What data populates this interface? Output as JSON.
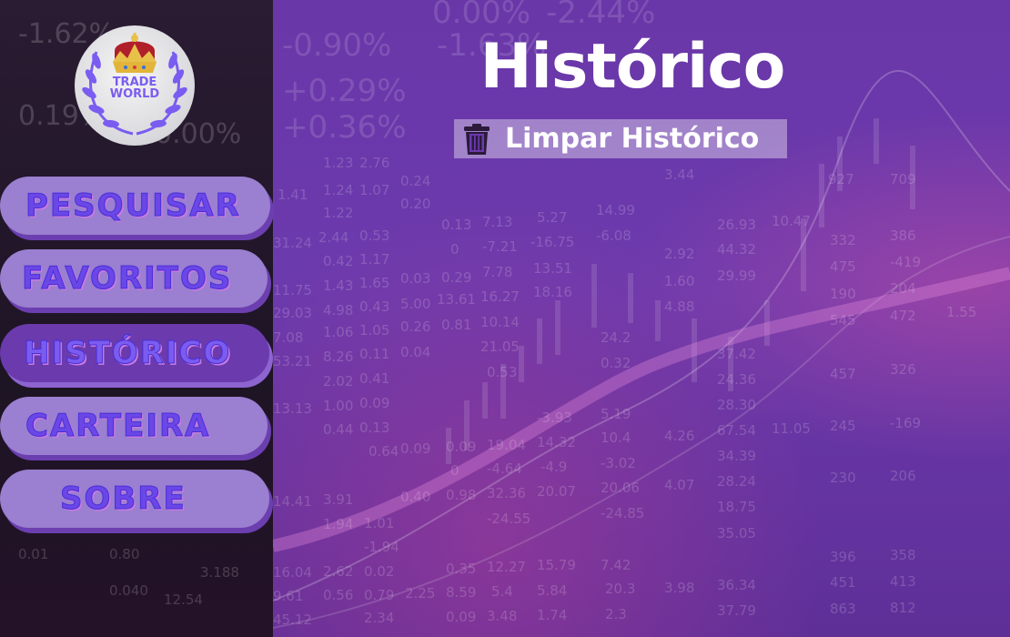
{
  "logo": {
    "line1": "TRADE",
    "line2": "WORLD"
  },
  "nav": {
    "items": [
      {
        "label": "PESQUISAR"
      },
      {
        "label": "FAVORITOS"
      },
      {
        "label": "HISTÓRICO"
      },
      {
        "label": "CARTEIRA"
      },
      {
        "label": "SOBRE"
      }
    ]
  },
  "page": {
    "title": "Histórico"
  },
  "actions": {
    "clear_history": "Limpar Histórico"
  },
  "colors": {
    "accent": "#6b3aad",
    "nav_bg": "#9b7fd0",
    "nav_text": "#6a47e6"
  }
}
